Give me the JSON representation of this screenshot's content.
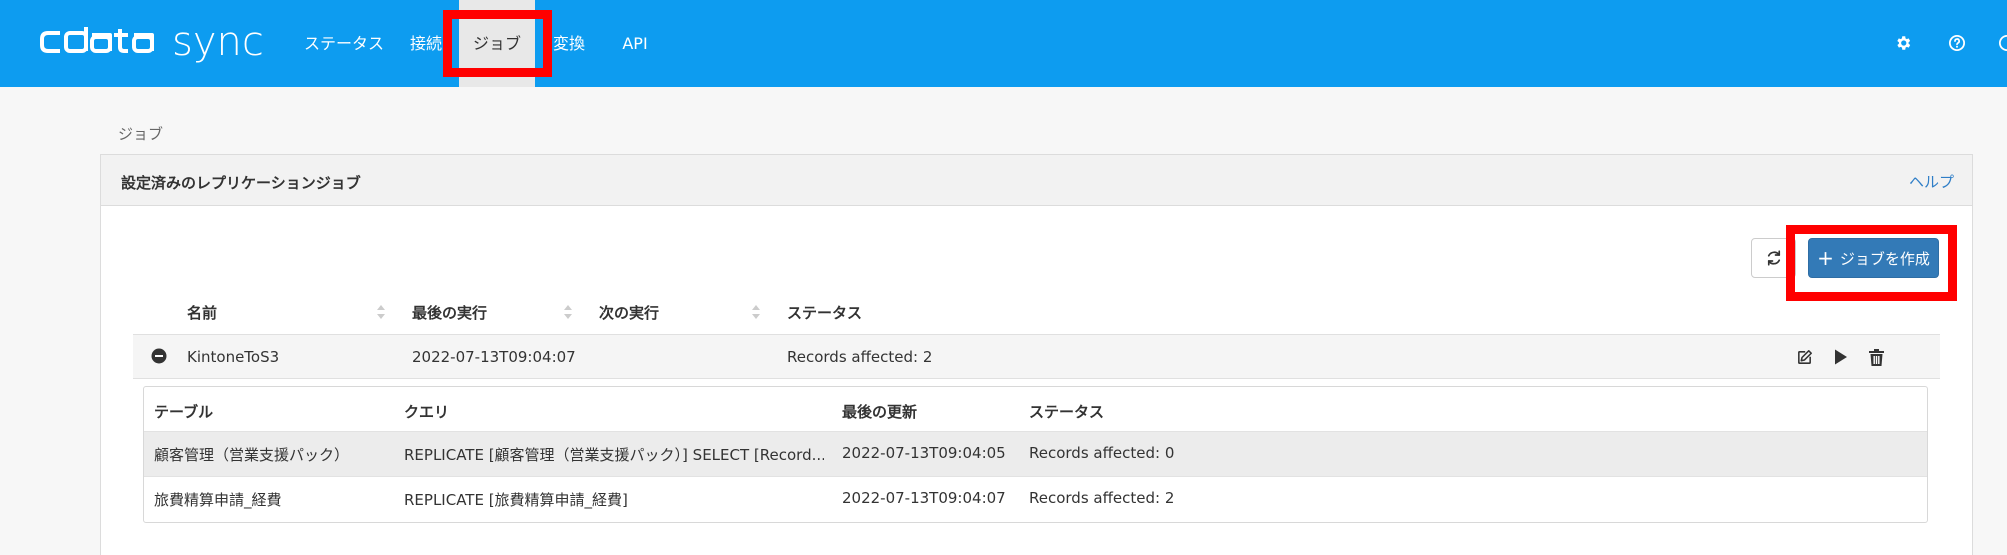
{
  "brand": {
    "logo_text": "cdata",
    "product": "sync"
  },
  "nav": {
    "items": [
      {
        "label": "ステータス"
      },
      {
        "label": "接続"
      },
      {
        "label": "ジョブ"
      },
      {
        "label": "変換"
      },
      {
        "label": "API"
      }
    ],
    "active": "ジョブ"
  },
  "header_icons": [
    "gear-icon",
    "help-icon",
    "user-icon"
  ],
  "breadcrumb": "ジョブ",
  "panel": {
    "title": "設定済みのレプリケーションジョブ",
    "help_label": "ヘルプ",
    "create_button_label": "ジョブを作成",
    "create_button_icon": "plus-icon",
    "refresh_icon": "refresh-icon"
  },
  "jobs_table": {
    "columns": [
      "名前",
      "最後の実行",
      "次の実行",
      "ステータス"
    ],
    "rows": [
      {
        "name": "KintoneToS3",
        "last_run": "2022-07-13T09:04:07",
        "next_run": "",
        "status": "Records affected: 2",
        "actions": [
          "edit-icon",
          "play-icon",
          "trash-icon"
        ]
      }
    ]
  },
  "detail_table": {
    "columns": [
      "テーブル",
      "クエリ",
      "最後の更新",
      "ステータス"
    ],
    "rows": [
      {
        "table": "顧客管理（営業支援パック）",
        "query": "REPLICATE [顧客管理（営業支援パック）] SELECT [Record...",
        "last_updated": "2022-07-13T09:04:05",
        "status": "Records affected: 0"
      },
      {
        "table": "旅費精算申請_経費",
        "query": "REPLICATE [旅費精算申請_経費]",
        "last_updated": "2022-07-13T09:04:07",
        "status": "Records affected: 2"
      }
    ]
  },
  "colors": {
    "topbar": "#0d9cf0",
    "active_tab": "#e8e8e8",
    "highlight": "#ff0000",
    "primary_button": "#337ab7",
    "link": "#2f7ec7"
  }
}
